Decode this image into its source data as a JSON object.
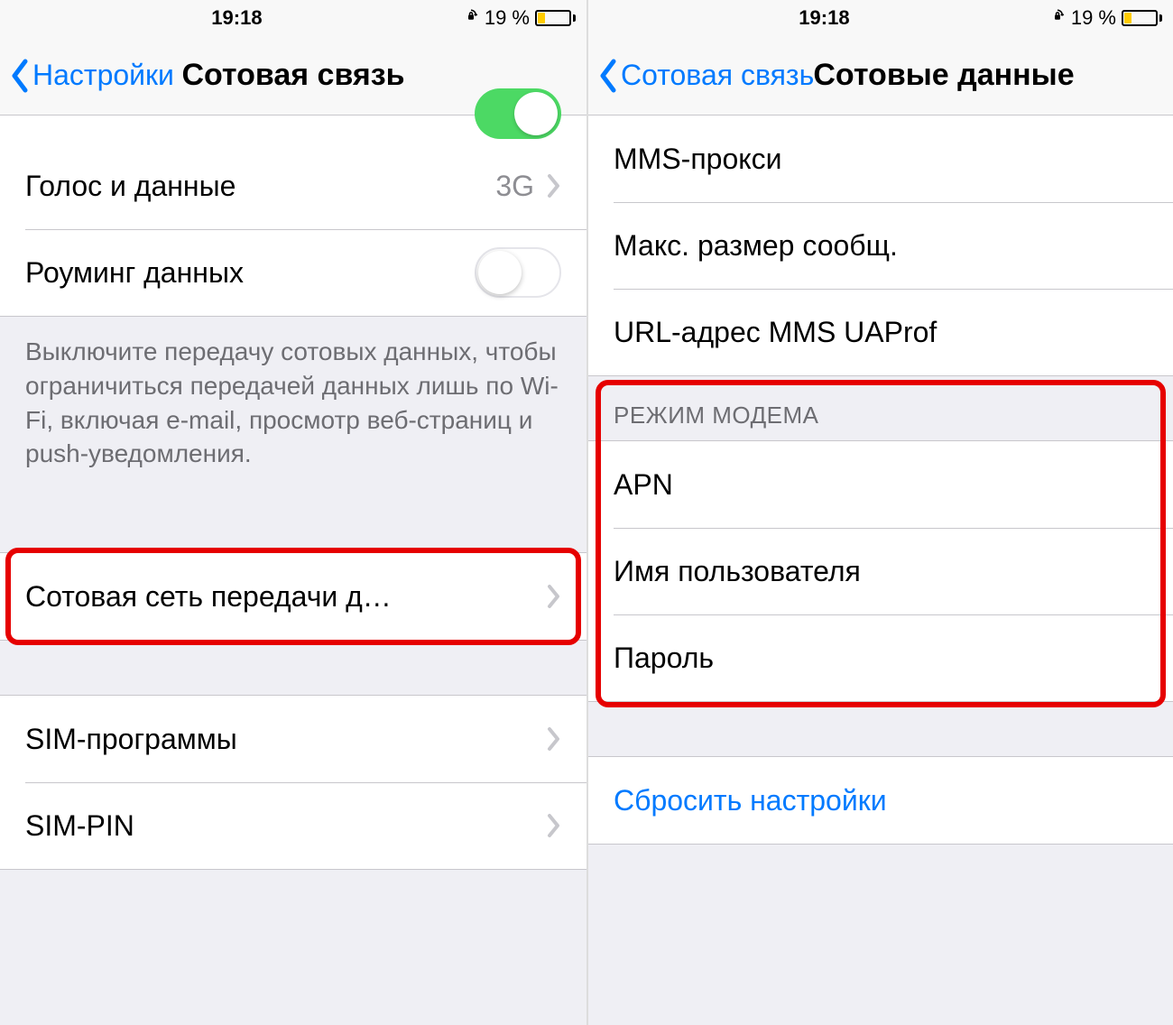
{
  "status": {
    "time": "19:18",
    "battery_pct": "19 %"
  },
  "left": {
    "back_label": "Настройки",
    "title": "Сотовая связь",
    "rows": {
      "voice_data_label": "Голос и данные",
      "voice_data_value": "3G",
      "roaming_label": "Роуминг данных",
      "footer": "Выключите передачу сотовых данных, чтобы ограничиться передачей данных лишь по Wi-Fi, включая e-mail, просмотр веб-страниц и push-уведомления.",
      "cellular_network_label": "Сотовая сеть передачи д…",
      "sim_apps_label": "SIM-программы",
      "sim_pin_label": "SIM-PIN"
    }
  },
  "right": {
    "back_label": "Сотовая связь",
    "title": "Сотовые данные",
    "rows": {
      "mms_proxy_label": "MMS-прокси",
      "max_msg_size_label": "Макс. размер сообщ.",
      "mms_uaprof_label": "URL-адрес MMS UAProf",
      "hotspot_header": "РЕЖИМ МОДЕМА",
      "apn_label": "APN",
      "username_label": "Имя пользователя",
      "password_label": "Пароль",
      "reset_label": "Сбросить настройки"
    }
  }
}
